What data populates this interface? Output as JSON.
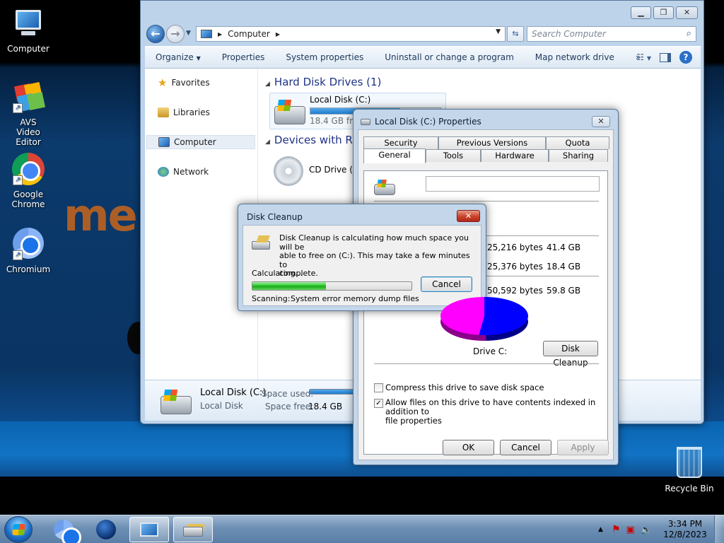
{
  "desktop": {
    "icons": [
      {
        "label": "Computer"
      },
      {
        "label": "AVS Video Editor"
      },
      {
        "label": "Google Chrome"
      },
      {
        "label": "Chromium"
      },
      {
        "label": "Recycle Bin"
      }
    ],
    "wallpaper_text": "me"
  },
  "explorer": {
    "address_segment": "Computer",
    "search_placeholder": "Search Computer",
    "commands": [
      "Organize",
      "Properties",
      "System properties",
      "Uninstall or change a program",
      "Map network drive",
      "»"
    ],
    "nav": [
      "Favorites",
      "Libraries",
      "Computer",
      "Network"
    ],
    "groups": {
      "hard_disks": "Hard Disk Drives (1)",
      "removable": "Devices with Rem"
    },
    "local_disk": {
      "name": "Local Disk (C:)",
      "free_text": "18.4 GB free",
      "used_fraction": 0.69
    },
    "cd_drive": {
      "name": "CD Drive (D:"
    },
    "details": {
      "name": "Local Disk (C:)",
      "type": "Local Disk",
      "space_used_label": "Space used:",
      "space_free_label": "Space free:",
      "space_free_value": "18.4 GB"
    }
  },
  "properties": {
    "title": "Local Disk (C:) Properties",
    "tabs_row1": [
      "Security",
      "Previous Versions",
      "Quota"
    ],
    "tabs_row2": [
      "General",
      "Tools",
      "Hardware",
      "Sharing"
    ],
    "active_tab": "General",
    "label_value": "",
    "rows": [
      {
        "bytes": "25,216 bytes",
        "size": "41.4 GB"
      },
      {
        "bytes": "25,376 bytes",
        "size": "18.4 GB"
      },
      {
        "bytes": "50,592 bytes",
        "size": "59.8 GB"
      }
    ],
    "drive_label": "Drive C:",
    "disk_cleanup_button": "Disk Cleanup",
    "compress_label": "Compress this drive to save disk space",
    "compress_checked": false,
    "index_label_line1": "Allow files on this drive to have contents indexed in addition to",
    "index_label_line2": "file properties",
    "index_checked": true,
    "ok": "OK",
    "cancel": "Cancel",
    "apply": "Apply",
    "pie_colors": {
      "used": "#0000ff",
      "free": "#ff00ff"
    }
  },
  "cleanup": {
    "title": "Disk Cleanup",
    "message_line1": "Disk Cleanup is calculating how much space you will be",
    "message_line2": "able to free on  (C:). This may take a few minutes to",
    "message_line3": "complete.",
    "status": "Calculating...",
    "progress": 0.46,
    "cancel": "Cancel",
    "scanning_label": "Scanning:",
    "scanning_item": "System error memory dump files"
  },
  "taskbar": {
    "time": "3:34 PM",
    "date": "12/8/2023"
  }
}
